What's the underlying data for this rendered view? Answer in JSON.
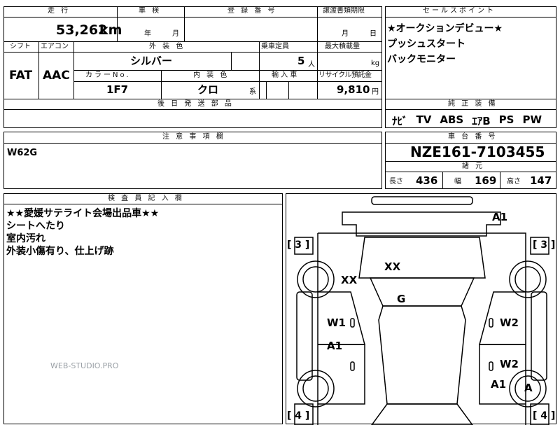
{
  "top_row": {
    "mileage_label": "走 行",
    "mileage_value": "53,262",
    "mileage_unit": "km",
    "inspection_label": "車 検",
    "inspection_year": "年",
    "inspection_month": "月",
    "registration_label": "登 録 番 号",
    "transfer_label": "譲渡書類期限",
    "transfer_month": "月",
    "transfer_day": "日",
    "sales_point_label": "セールスポイント"
  },
  "spec_row": {
    "shift_label": "シフト",
    "shift_value": "FAT",
    "aircon_label": "エアコン",
    "aircon_value": "AAC",
    "exterior_color_label": "外 装 色",
    "exterior_color_value": "シルバー",
    "capacity_label": "乗車定員",
    "capacity_value": "5",
    "capacity_unit": "人",
    "max_load_label": "最大積載量",
    "max_load_unit": "kg",
    "color_no_label": "カラーNo.",
    "color_no_value": "1F7",
    "interior_color_label": "内 装 色",
    "interior_color_value": "クロ",
    "interior_color_suffix": "系",
    "import_label": "輸 入 車",
    "recycle_label": "リサイクル預託金",
    "recycle_value": "9,810",
    "recycle_unit": "円",
    "later_parts_label": "後 日 発 送 部 品"
  },
  "sales_points": [
    "★オークションデビュー★",
    "プッシュスタート",
    "バックモニター"
  ],
  "equipment": {
    "label": "純 正 装 備",
    "items": [
      "ﾅﾋﾞ",
      "TV",
      "ABS",
      "ｴｱB",
      "PS",
      "PW"
    ]
  },
  "caution": {
    "label": "注 意 事 項 欄",
    "text": "W62G"
  },
  "chassis": {
    "label": "車 台 番 号",
    "value": "NZE161-7103455",
    "dims_label": "諸 元",
    "length_label": "長さ",
    "length_value": "436",
    "width_label": "幅",
    "width_value": "169",
    "height_label": "高さ",
    "height_value": "147"
  },
  "inspector": {
    "label": "検 査 員 記 入 欄",
    "lines": [
      "★★愛媛サテライト会場出品車★★",
      "シートへたり",
      "室内汚れ",
      "外装小傷有り、仕上げ跡"
    ],
    "watermark": "WEB-STUDIO.PRO"
  },
  "diagram": {
    "marks": [
      "A1",
      "XX",
      "XX",
      "G",
      "W1",
      "W2",
      "A1",
      "W2",
      "A1",
      "A"
    ],
    "brackets": [
      "[ 3 ]",
      "[ 3 ]",
      "[ 4 ]",
      "[ 4 ]"
    ]
  }
}
